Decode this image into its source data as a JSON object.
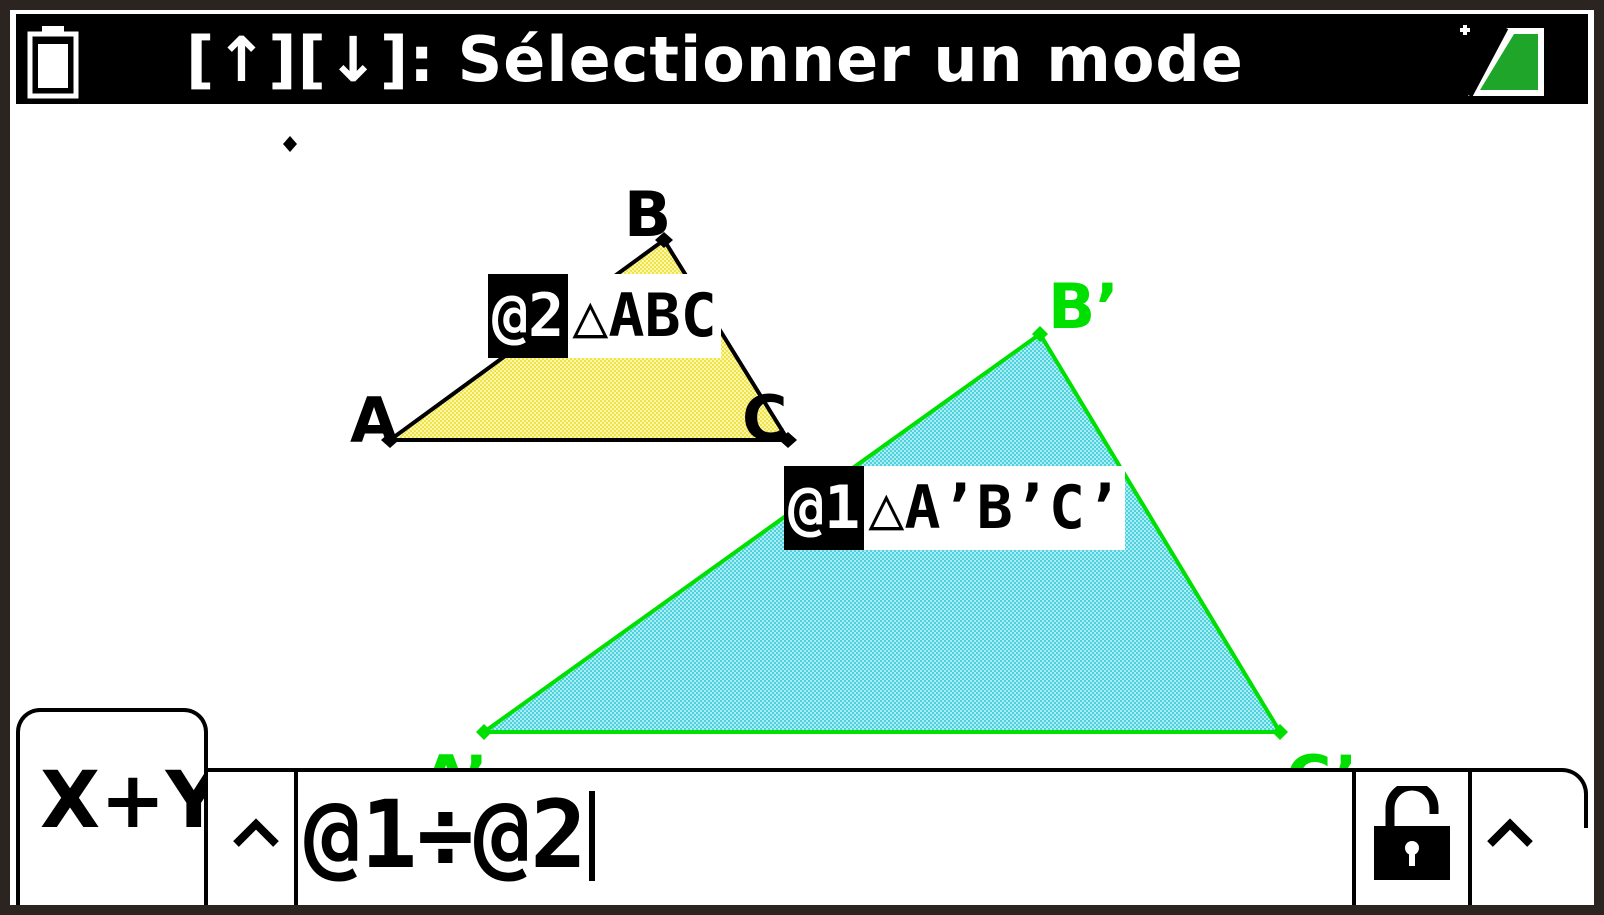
{
  "status_bar": {
    "hint": "[↑][↓]: Sélectionner un mode",
    "left_icon": "battery-icon",
    "right_icon": "shift-indicator-icon"
  },
  "geometry": {
    "small_triangle": {
      "fill_color": "#f5f07a",
      "vertex_labels": [
        "A",
        "B",
        "C"
      ],
      "label_tag": "@2",
      "label_text": "△ABC"
    },
    "large_triangle": {
      "fill_color": "#7ee3ec",
      "edge_color": "#00e000",
      "vertex_labels": [
        "A’",
        "B’",
        "C’"
      ],
      "label_tag": "@1",
      "label_text": "△A’B’C’"
    }
  },
  "bottom_bar": {
    "tab_label": "X+Y",
    "expression": "@1÷@2",
    "left_caret_icon": "caret-up-icon",
    "lock_icon": "unlocked-padlock-icon",
    "right_caret_icon": "caret-up-icon"
  }
}
